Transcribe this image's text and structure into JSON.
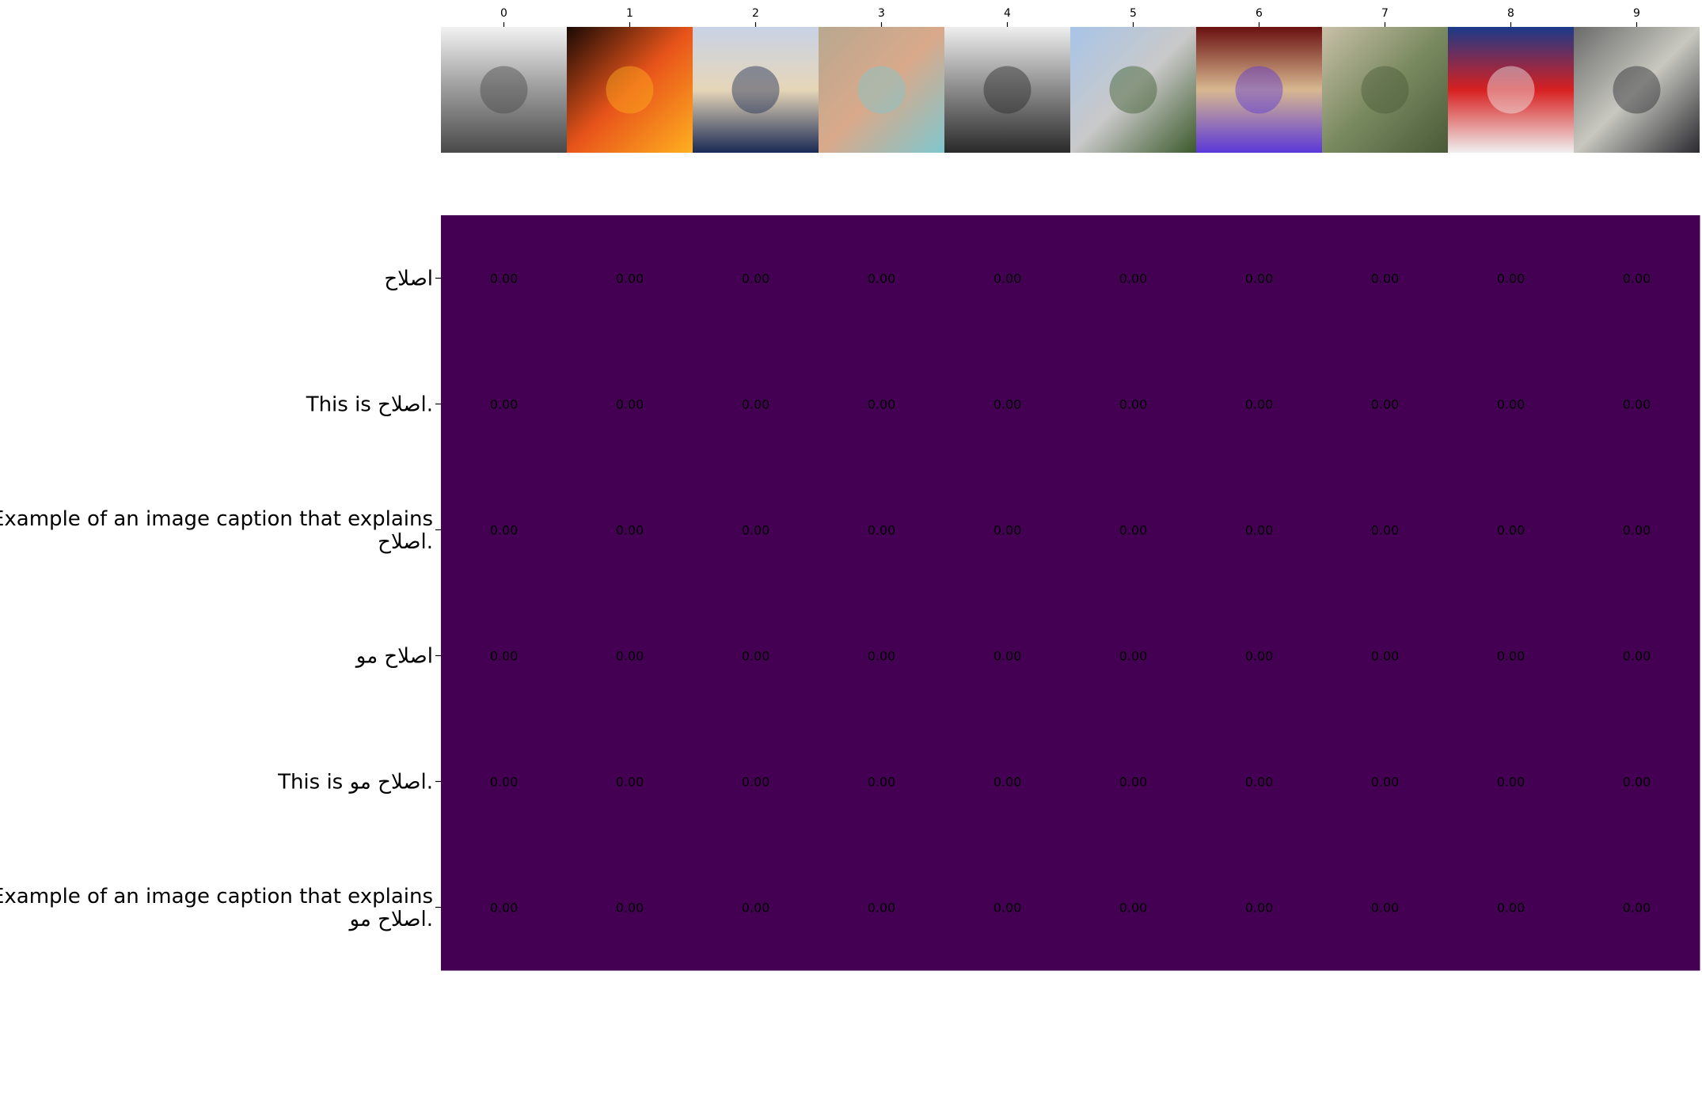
{
  "chart_data": {
    "type": "heatmap",
    "title": "",
    "xlabel": "",
    "ylabel": "",
    "x_tick_labels": [
      "0",
      "1",
      "2",
      "3",
      "4",
      "5",
      "6",
      "7",
      "8",
      "9"
    ],
    "y_tick_labels": [
      [
        "اصلاح"
      ],
      [
        "This is اصلاح."
      ],
      [
        "Example of an image caption that explains",
        "اصلاح."
      ],
      [
        "اصلاح مو"
      ],
      [
        "This is اصلاح مو."
      ],
      [
        "Example of an image caption that explains",
        "اصلاح مو."
      ]
    ],
    "images": [
      {
        "name": "engraving-machinery",
        "colors": [
          "#f2f2f2",
          "#9a9a9a",
          "#4a4a4a"
        ]
      },
      {
        "name": "furnace-fire",
        "colors": [
          "#1a0a05",
          "#e8541a",
          "#ffb020"
        ]
      },
      {
        "name": "tongue-depressors",
        "colors": [
          "#c8d2e6",
          "#e6d6b8",
          "#1a2a55"
        ]
      },
      {
        "name": "woman-portrait",
        "colors": [
          "#b8a890",
          "#d9a98a",
          "#7fc7cf"
        ]
      },
      {
        "name": "smokestack-tower",
        "colors": [
          "#eeeeee",
          "#8a8a8a",
          "#2a2a2a"
        ]
      },
      {
        "name": "propeller-sculpture",
        "colors": [
          "#a8c4e8",
          "#c9c9c9",
          "#3c5a2c"
        ]
      },
      {
        "name": "lamp-device",
        "colors": [
          "#6a1010",
          "#d8b890",
          "#5a38d8"
        ]
      },
      {
        "name": "green-transformer",
        "colors": [
          "#c8c0a8",
          "#7a8a60",
          "#4a5a38"
        ]
      },
      {
        "name": "space-shuttle",
        "colors": [
          "#1a3a8a",
          "#d82020",
          "#f0f0f0"
        ]
      },
      {
        "name": "space-station",
        "colors": [
          "#6a6a6a",
          "#c8c8c0",
          "#2a2a30"
        ]
      }
    ],
    "values": [
      [
        0.0,
        0.0,
        0.0,
        0.0,
        0.0,
        0.0,
        0.0,
        0.0,
        0.0,
        0.0
      ],
      [
        0.0,
        0.0,
        0.0,
        0.0,
        0.0,
        0.0,
        0.0,
        0.0,
        0.0,
        0.0
      ],
      [
        0.0,
        0.0,
        0.0,
        0.0,
        0.0,
        0.0,
        0.0,
        0.0,
        0.0,
        0.0
      ],
      [
        0.0,
        0.0,
        0.0,
        0.0,
        0.0,
        0.0,
        0.0,
        0.0,
        0.0,
        0.0
      ],
      [
        0.0,
        0.0,
        0.0,
        0.0,
        0.0,
        0.0,
        0.0,
        0.0,
        0.0,
        0.0
      ],
      [
        0.0,
        0.0,
        0.0,
        0.0,
        0.0,
        0.0,
        0.0,
        0.0,
        0.0,
        0.0
      ]
    ],
    "value_format": "0.00",
    "colormap": "viridis",
    "cell_color": "#440154",
    "annotation_color": "#000000",
    "grid": false,
    "legend": "none"
  }
}
